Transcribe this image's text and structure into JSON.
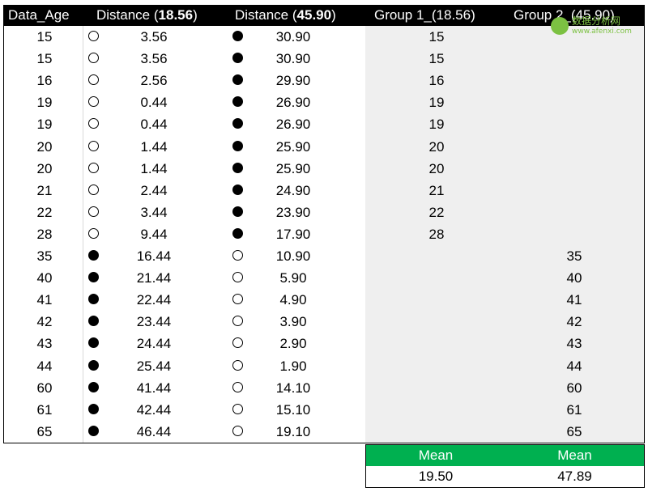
{
  "headers": {
    "age": "Data_Age",
    "dist1_prefix": "Distance (",
    "dist1_value": "18.56",
    "dist1_suffix": ")",
    "dist2_prefix": "Distance (",
    "dist2_value": "45.90",
    "dist2_suffix": ")",
    "group1": "Group 1_(18.56)",
    "group2": "Group 2_(45.90)"
  },
  "rows": [
    {
      "age": "15",
      "d1": "3.56",
      "d2": "30.90",
      "g1": "15",
      "g2": "",
      "nearer": "group1"
    },
    {
      "age": "15",
      "d1": "3.56",
      "d2": "30.90",
      "g1": "15",
      "g2": "",
      "nearer": "group1"
    },
    {
      "age": "16",
      "d1": "2.56",
      "d2": "29.90",
      "g1": "16",
      "g2": "",
      "nearer": "group1"
    },
    {
      "age": "19",
      "d1": "0.44",
      "d2": "26.90",
      "g1": "19",
      "g2": "",
      "nearer": "group1"
    },
    {
      "age": "19",
      "d1": "0.44",
      "d2": "26.90",
      "g1": "19",
      "g2": "",
      "nearer": "group1"
    },
    {
      "age": "20",
      "d1": "1.44",
      "d2": "25.90",
      "g1": "20",
      "g2": "",
      "nearer": "group1"
    },
    {
      "age": "20",
      "d1": "1.44",
      "d2": "25.90",
      "g1": "20",
      "g2": "",
      "nearer": "group1"
    },
    {
      "age": "21",
      "d1": "2.44",
      "d2": "24.90",
      "g1": "21",
      "g2": "",
      "nearer": "group1"
    },
    {
      "age": "22",
      "d1": "3.44",
      "d2": "23.90",
      "g1": "22",
      "g2": "",
      "nearer": "group1"
    },
    {
      "age": "28",
      "d1": "9.44",
      "d2": "17.90",
      "g1": "28",
      "g2": "",
      "nearer": "group1"
    },
    {
      "age": "35",
      "d1": "16.44",
      "d2": "10.90",
      "g1": "",
      "g2": "35",
      "nearer": "group2"
    },
    {
      "age": "40",
      "d1": "21.44",
      "d2": "5.90",
      "g1": "",
      "g2": "40",
      "nearer": "group2"
    },
    {
      "age": "41",
      "d1": "22.44",
      "d2": "4.90",
      "g1": "",
      "g2": "41",
      "nearer": "group2"
    },
    {
      "age": "42",
      "d1": "23.44",
      "d2": "3.90",
      "g1": "",
      "g2": "42",
      "nearer": "group2"
    },
    {
      "age": "43",
      "d1": "24.44",
      "d2": "2.90",
      "g1": "",
      "g2": "43",
      "nearer": "group2"
    },
    {
      "age": "44",
      "d1": "25.44",
      "d2": "1.90",
      "g1": "",
      "g2": "44",
      "nearer": "group2"
    },
    {
      "age": "60",
      "d1": "41.44",
      "d2": "14.10",
      "g1": "",
      "g2": "60",
      "nearer": "group2"
    },
    {
      "age": "61",
      "d1": "42.44",
      "d2": "15.10",
      "g1": "",
      "g2": "61",
      "nearer": "group2"
    },
    {
      "age": "65",
      "d1": "46.44",
      "d2": "19.10",
      "g1": "",
      "g2": "65",
      "nearer": "group2"
    }
  ],
  "mean": {
    "label1": "Mean",
    "label2": "Mean",
    "value1": "19.50",
    "value2": "47.89"
  },
  "colors": {
    "header_bg": "#000000",
    "header_text": "#ffffff",
    "group_panel_bg": "#efefef",
    "mean_header_bg": "#00b050",
    "watermark": "#7cc142"
  },
  "watermark": {
    "title": "数据分析网",
    "site": "www.afenxi.com"
  }
}
